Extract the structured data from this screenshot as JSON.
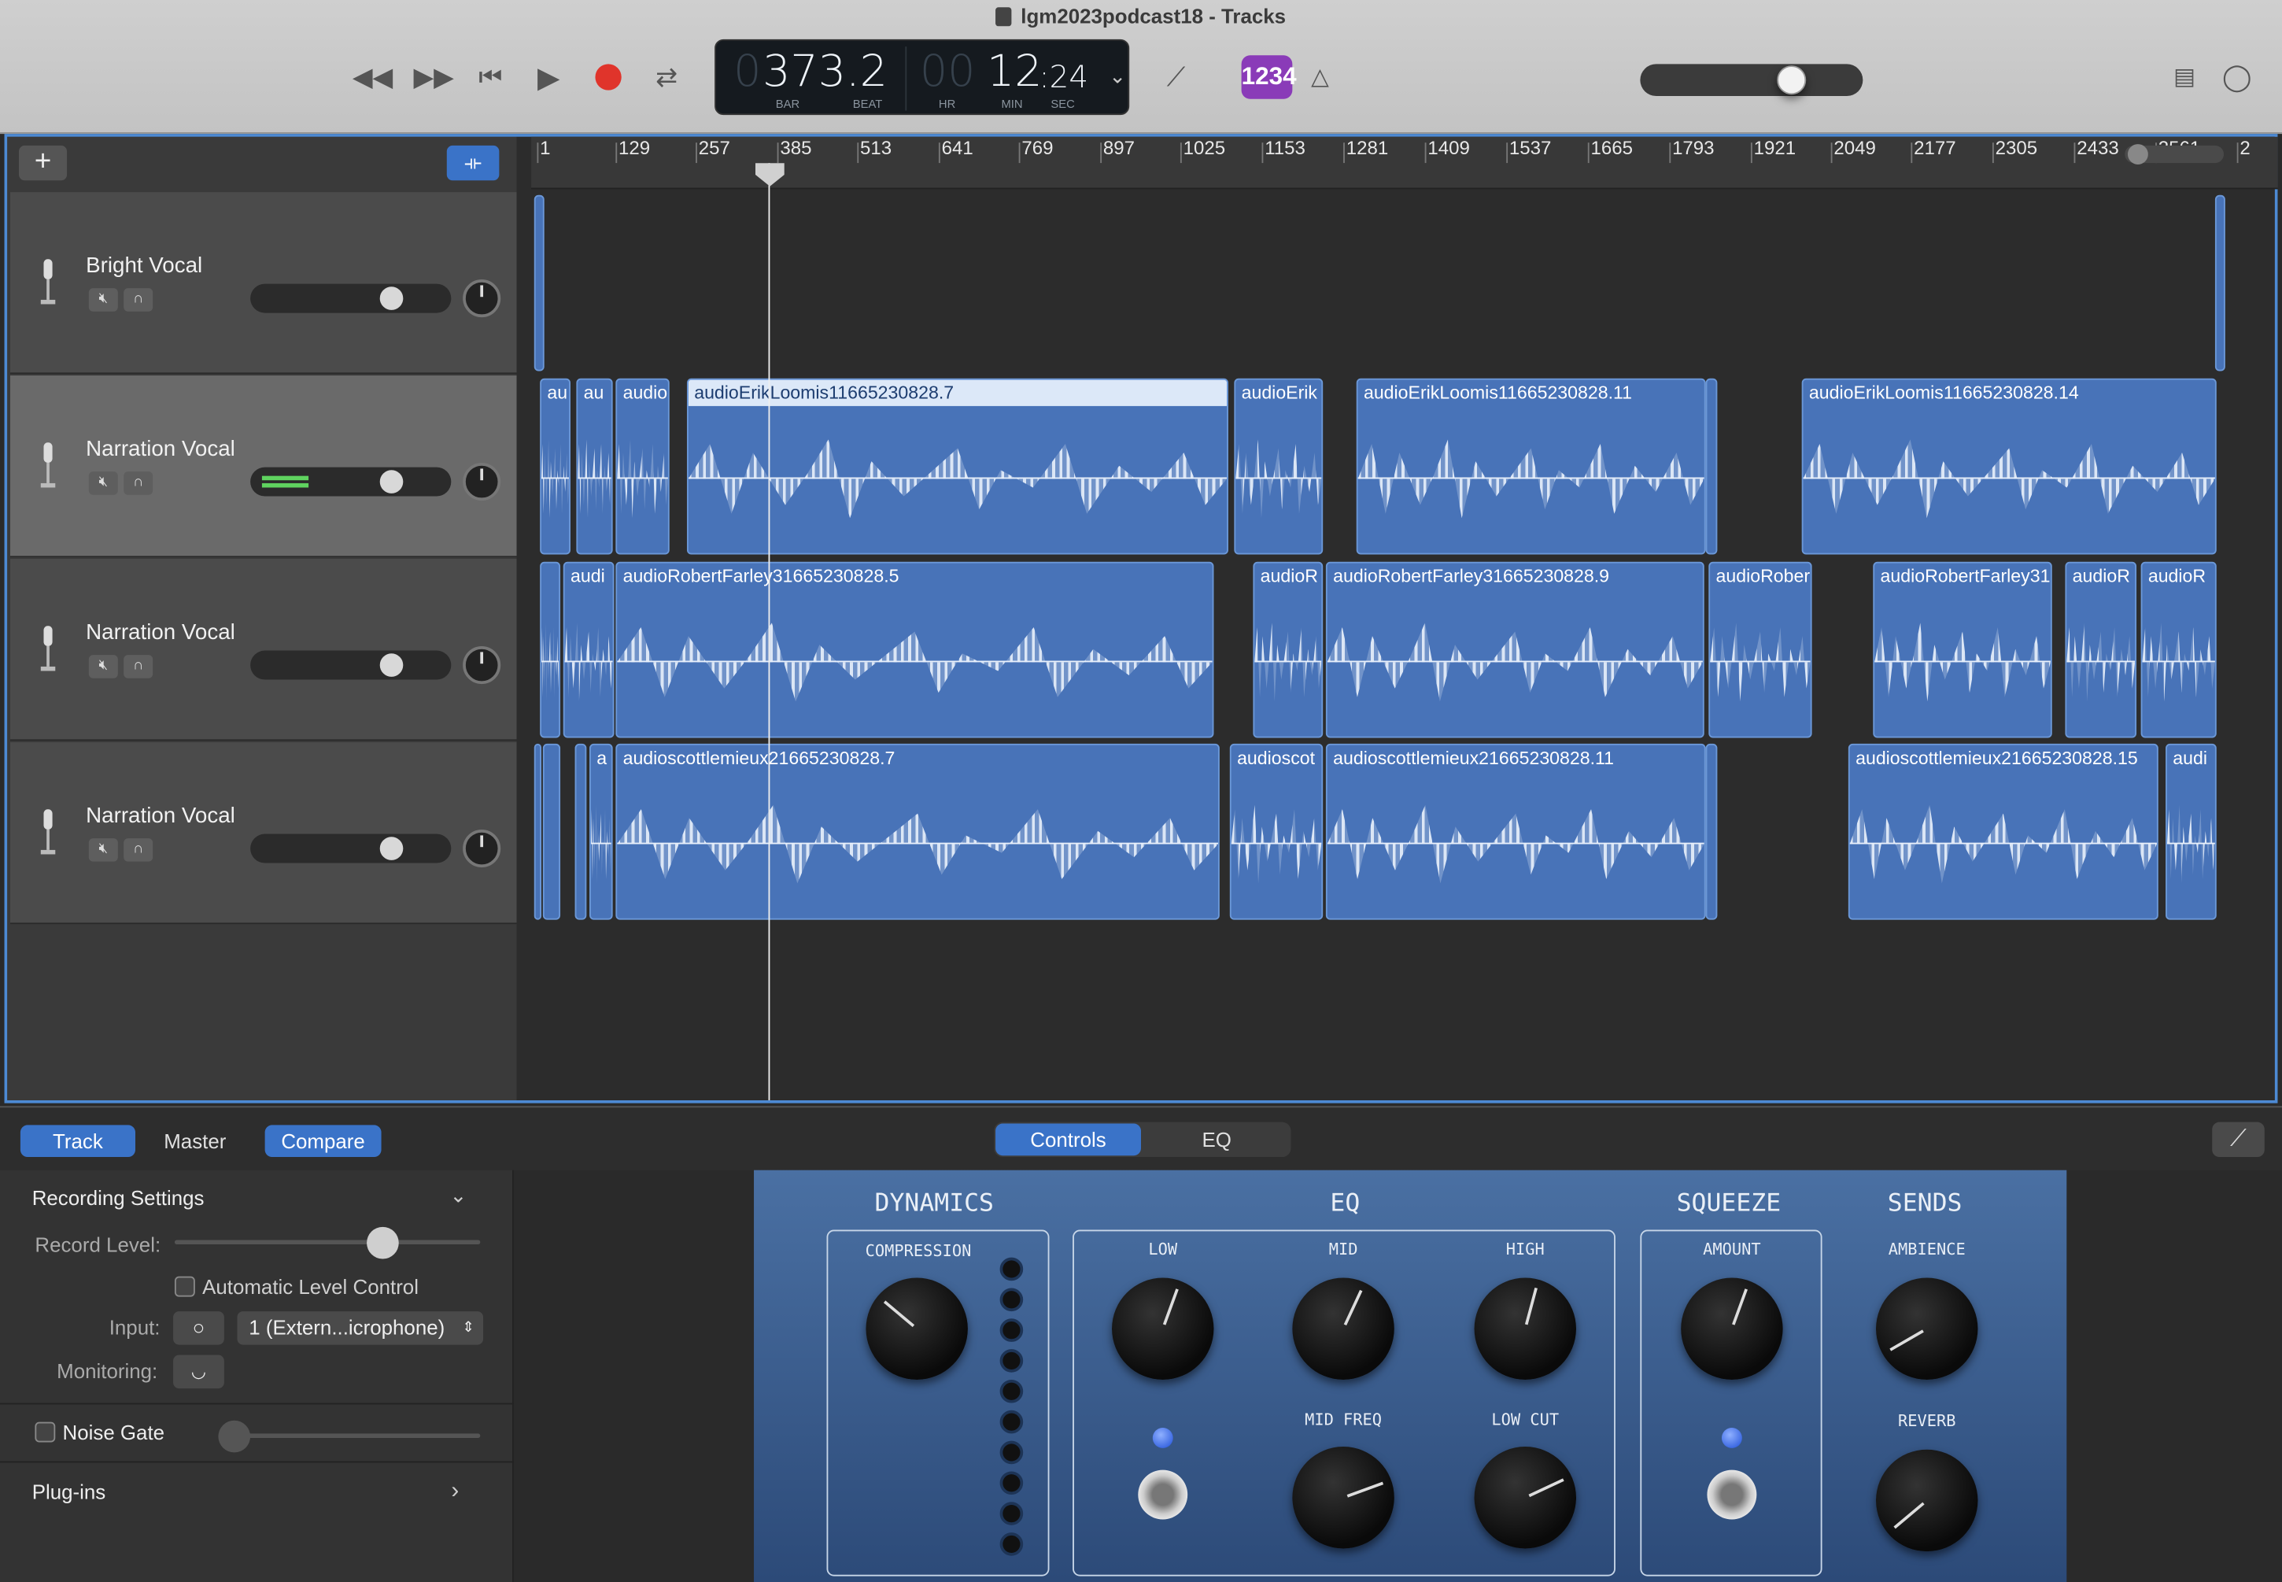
{
  "window": {
    "title": "lgm2023podcast18 - Tracks"
  },
  "transport": {
    "bar": "373.2",
    "bar_dim": "0",
    "beat_label": "BAR",
    "beat2_label": "BEAT",
    "hr": "00",
    "min": "12",
    "sec": ":24",
    "hr_label": "HR",
    "min_label": "MIN",
    "sec_label": "SEC",
    "count_in": "1234"
  },
  "toolbar": {
    "add": "+"
  },
  "ruler": [
    "1",
    "129",
    "257",
    "385",
    "513",
    "641",
    "769",
    "897",
    "1025",
    "1153",
    "1281",
    "1409",
    "1537",
    "1665",
    "1793",
    "1921",
    "2049",
    "2177",
    "2305",
    "2433",
    "2561",
    "2"
  ],
  "tracks": [
    {
      "name": "Bright Vocal"
    },
    {
      "name": "Narration Vocal"
    },
    {
      "name": "Narration Vocal"
    },
    {
      "name": "Narration Vocal"
    }
  ],
  "regions": {
    "t2": [
      "au",
      "au",
      "audio",
      "audioErikLoomis11665230828.7",
      "audioErik",
      "audioErikLoomis11665230828.11",
      "audioErikLoomis11665230828.14"
    ],
    "t3": [
      "audi",
      "audioRobertFarley31665230828.5",
      "audioR",
      "audioRobertFarley31665230828.9",
      "audioRober",
      "audioRobertFarley31",
      "audioR",
      "audioR"
    ],
    "t4": [
      "a",
      "audioscottlemieux21665230828.7",
      "audioscot",
      "audioscottlemieux21665230828.11",
      "audioscottlemieux21665230828.15",
      "audi"
    ]
  },
  "bottom": {
    "track": "Track",
    "master": "Master",
    "compare": "Compare",
    "controls": "Controls",
    "eq": "EQ"
  },
  "inspector": {
    "recording_settings": "Recording Settings",
    "record_level": "Record Level:",
    "auto_level": "Automatic Level Control",
    "input": "Input:",
    "input_value": "1 (Extern...icrophone)",
    "monitoring": "Monitoring:",
    "noise_gate": "Noise Gate",
    "plugins": "Plug-ins"
  },
  "plugin": {
    "dynamics": "DYNAMICS",
    "eq": "EQ",
    "squeeze": "SQUEEZE",
    "sends": "SENDS",
    "compression": "COMPRESSION",
    "low": "LOW",
    "mid": "MID",
    "high": "HIGH",
    "mid_freq": "MID FREQ",
    "low_cut": "LOW CUT",
    "amount": "AMOUNT",
    "ambience": "AMBIENCE",
    "reverb": "REVERB"
  },
  "colors": {
    "accent": "#3a73c8",
    "region": "#4873b8",
    "record": "#e0342b",
    "count_in": "#8a3bb8"
  }
}
